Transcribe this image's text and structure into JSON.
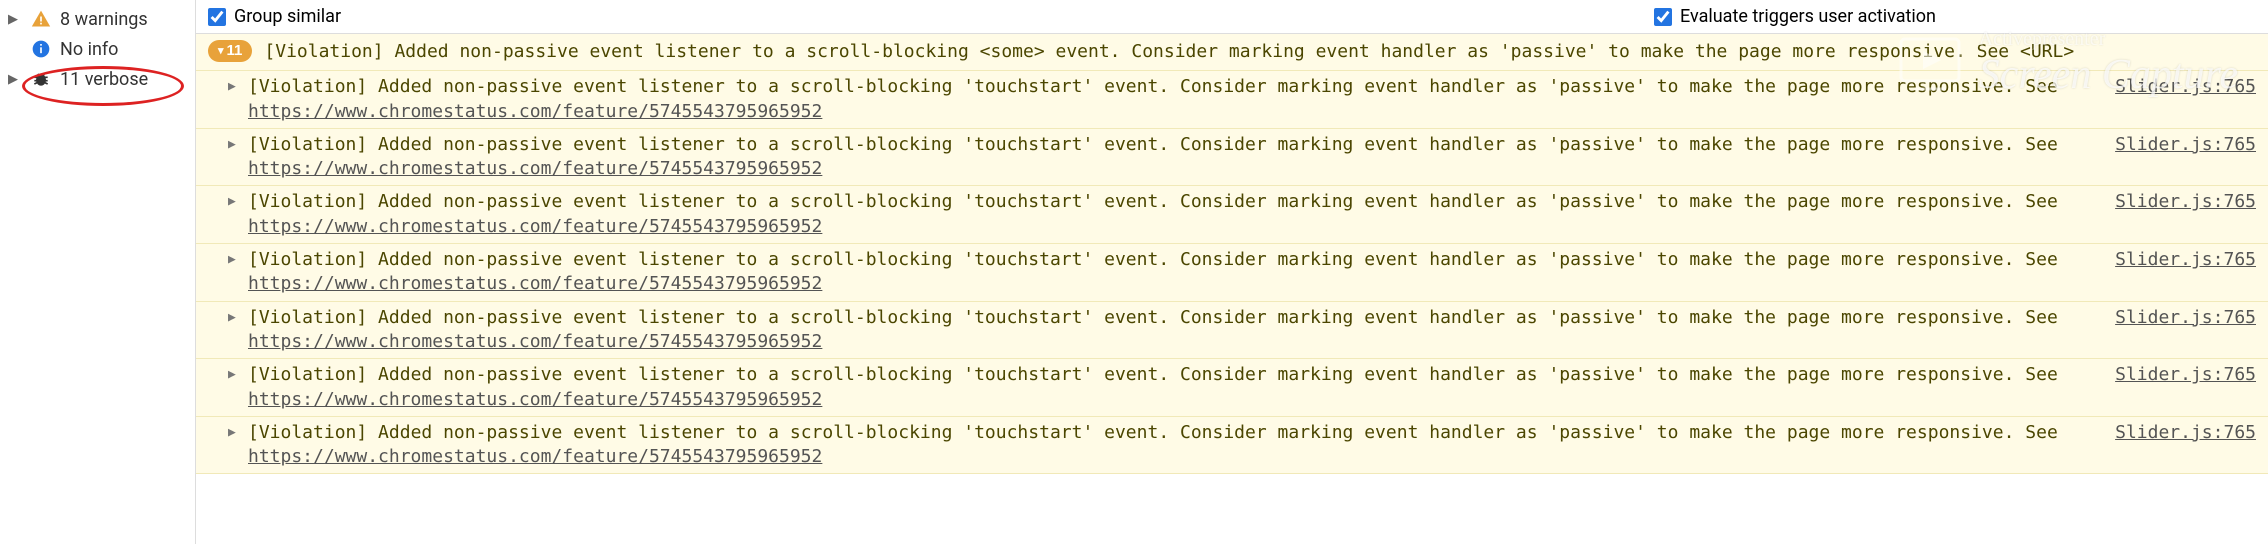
{
  "sidebar": {
    "items": [
      {
        "label": "8 warnings",
        "icon": "warning",
        "expandable": true
      },
      {
        "label": "No info",
        "icon": "info",
        "expandable": false
      },
      {
        "label": "11 verbose",
        "icon": "verbose",
        "expandable": true,
        "highlighted": true
      }
    ]
  },
  "topbar": {
    "group_similar": {
      "label": "Group similar",
      "checked": true
    },
    "evaluate_triggers": {
      "label": "Evaluate triggers user activation",
      "checked": true
    }
  },
  "console": {
    "group": {
      "count": "11",
      "prefix": "[Violation]",
      "text_a": " Added non-passive event listener to a scroll-blocking <some> event. Consider marking event handler as 'passive' to make the page more responsive. See ",
      "url_text": "<URL>"
    },
    "entries": [
      {
        "prefix": "[Violation]",
        "text_a": " Added non-passive event listener to a scroll-blocking 'touchstart' event. Consider marking event handler as 'passive' to make the page more responsive. See ",
        "url": "https://www.chromestatus.com/feature/5745543795965952",
        "source": "Slider.js:765"
      },
      {
        "prefix": "[Violation]",
        "text_a": " Added non-passive event listener to a scroll-blocking 'touchstart' event. Consider marking event handler as 'passive' to make the page more responsive. See ",
        "url": "https://www.chromestatus.com/feature/5745543795965952",
        "source": "Slider.js:765"
      },
      {
        "prefix": "[Violation]",
        "text_a": " Added non-passive event listener to a scroll-blocking 'touchstart' event. Consider marking event handler as 'passive' to make the page more responsive. See ",
        "url": "https://www.chromestatus.com/feature/5745543795965952",
        "source": "Slider.js:765"
      },
      {
        "prefix": "[Violation]",
        "text_a": " Added non-passive event listener to a scroll-blocking 'touchstart' event. Consider marking event handler as 'passive' to make the page more responsive. See ",
        "url": "https://www.chromestatus.com/feature/5745543795965952",
        "source": "Slider.js:765"
      },
      {
        "prefix": "[Violation]",
        "text_a": " Added non-passive event listener to a scroll-blocking 'touchstart' event. Consider marking event handler as 'passive' to make the page more responsive. See ",
        "url": "https://www.chromestatus.com/feature/5745543795965952",
        "source": "Slider.js:765"
      },
      {
        "prefix": "[Violation]",
        "text_a": " Added non-passive event listener to a scroll-blocking 'touchstart' event. Consider marking event handler as 'passive' to make the page more responsive. See ",
        "url": "https://www.chromestatus.com/feature/5745543795965952",
        "source": "Slider.js:765"
      },
      {
        "prefix": "[Violation]",
        "text_a": " Added non-passive event listener to a scroll-blocking 'touchstart' event. Consider marking event handler as 'passive' to make the page more responsive. See ",
        "url": "https://www.chromestatus.com/feature/5745543795965952",
        "source": "Slider.js:765"
      }
    ]
  },
  "watermark": {
    "text": "Screen Capture",
    "sub": "Activepresenter"
  }
}
